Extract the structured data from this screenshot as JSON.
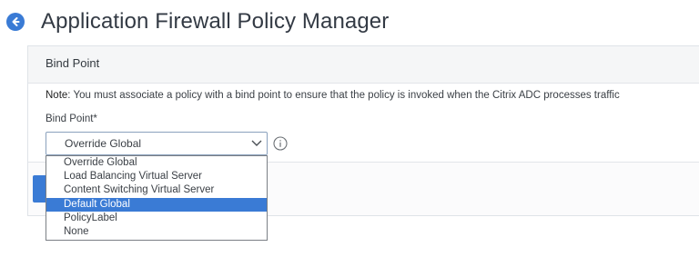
{
  "header": {
    "title": "Application Firewall Policy Manager",
    "back_icon": "back-arrow-icon"
  },
  "panel": {
    "title": "Bind Point",
    "note_label": "Note",
    "note_text": ":  You must associate a policy with a bind point to ensure that the policy is invoked when the Citrix ADC processes traffic",
    "field_label": "Bind Point*",
    "select_value": "Override Global",
    "info_icon": "info-icon"
  },
  "dropdown": {
    "options": [
      "Override Global",
      "Load Balancing Virtual Server",
      "Content Switching Virtual Server",
      "Default Global",
      "PolicyLabel",
      "None"
    ],
    "highlighted": "Default Global"
  },
  "colors": {
    "accent": "#3a7bd5",
    "title": "#333a44",
    "border": "#dfe3e8"
  }
}
